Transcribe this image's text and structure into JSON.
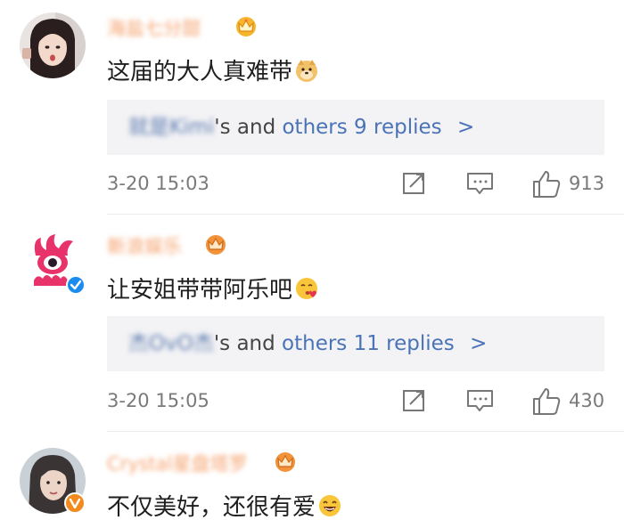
{
  "comments": [
    {
      "username": "海盐七分甜",
      "text": "这届的大人真难带",
      "emoji": "doge-emoji",
      "replies": {
        "name": "就是Kimi",
        "suffix": "'s and ",
        "link": "others 9 replies",
        "chevron": ">"
      },
      "time": "3-20 15:03",
      "likes": "913"
    },
    {
      "username": "新浪娱乐",
      "text": "让安姐带带阿乐吧",
      "emoji": "kiss-emoji",
      "verified": true,
      "replies": {
        "name": "杰OvO杰",
        "suffix": "'s and ",
        "link": "others 11 replies",
        "chevron": ">"
      },
      "time": "3-20 15:05",
      "likes": "430"
    },
    {
      "username": "Crystal星盘塔罗",
      "text": "不仅美好，还很有爱",
      "emoji": "laugh-emoji"
    }
  ],
  "colors": {
    "link": "#4a73b8",
    "username": "#f5a06c",
    "verified": "#1a8cf0"
  }
}
